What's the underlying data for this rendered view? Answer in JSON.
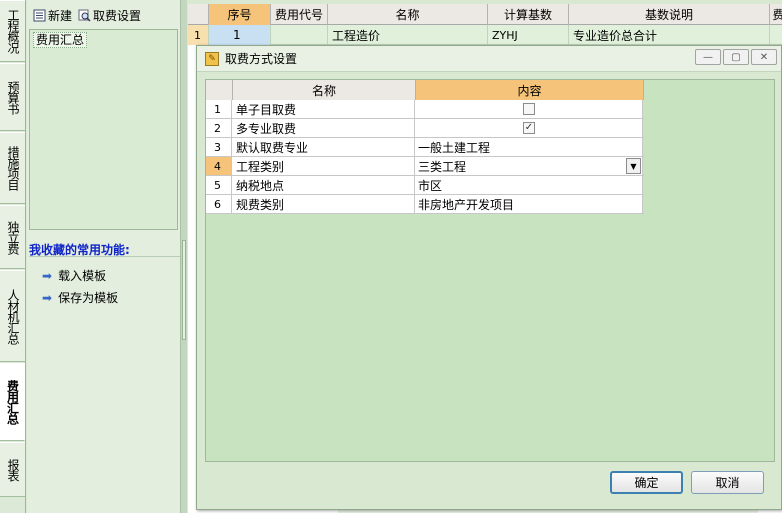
{
  "vertical_tabs": [
    {
      "label": "工程概况",
      "active": false
    },
    {
      "label": "预算书",
      "active": false
    },
    {
      "label": "措施项目",
      "active": false
    },
    {
      "label": "独立费",
      "active": false
    },
    {
      "label": "人材机汇总",
      "active": false
    },
    {
      "label": "费用汇总",
      "active": true
    },
    {
      "label": "报表",
      "active": false
    }
  ],
  "left_toolbar": {
    "new_label": "新建",
    "new_icon": "document-list-icon",
    "fee_setting_label": "取费设置",
    "fee_setting_icon": "magnifier-icon"
  },
  "tree": {
    "root": "费用汇总"
  },
  "favorites": {
    "title": "我收藏的常用功能:",
    "items": [
      "载入模板",
      "保存为模板"
    ],
    "item_icon": "arrow-right-icon"
  },
  "main_grid": {
    "columns": [
      "",
      "序号",
      "费用代号",
      "名称",
      "计算基数",
      "基数说明",
      "费"
    ],
    "row": {
      "rownum": "1",
      "seq": "1",
      "code": "",
      "name": "工程造价",
      "base": "ZYHJ",
      "desc": "专业造价总合计"
    }
  },
  "dialog": {
    "title": "取费方式设置",
    "columns": [
      "名称",
      "内容"
    ],
    "rows": [
      {
        "num": "1",
        "name": "单子目取费",
        "type": "checkbox",
        "value": "",
        "checked": false
      },
      {
        "num": "2",
        "name": "多专业取费",
        "type": "checkbox",
        "value": "",
        "checked": true
      },
      {
        "num": "3",
        "name": "默认取费专业",
        "type": "text",
        "value": "一般土建工程"
      },
      {
        "num": "4",
        "name": "工程类别",
        "type": "select",
        "value": "三类工程"
      },
      {
        "num": "5",
        "name": "纳税地点",
        "type": "text",
        "value": "市区"
      },
      {
        "num": "6",
        "name": "规费类别",
        "type": "text",
        "value": "非房地产开发项目"
      }
    ],
    "ok_label": "确定",
    "cancel_label": "取消"
  },
  "colors": {
    "accent_header": "#f5c37a",
    "panel_green": "#d9e8d1",
    "fav_title": "#1024c8"
  }
}
